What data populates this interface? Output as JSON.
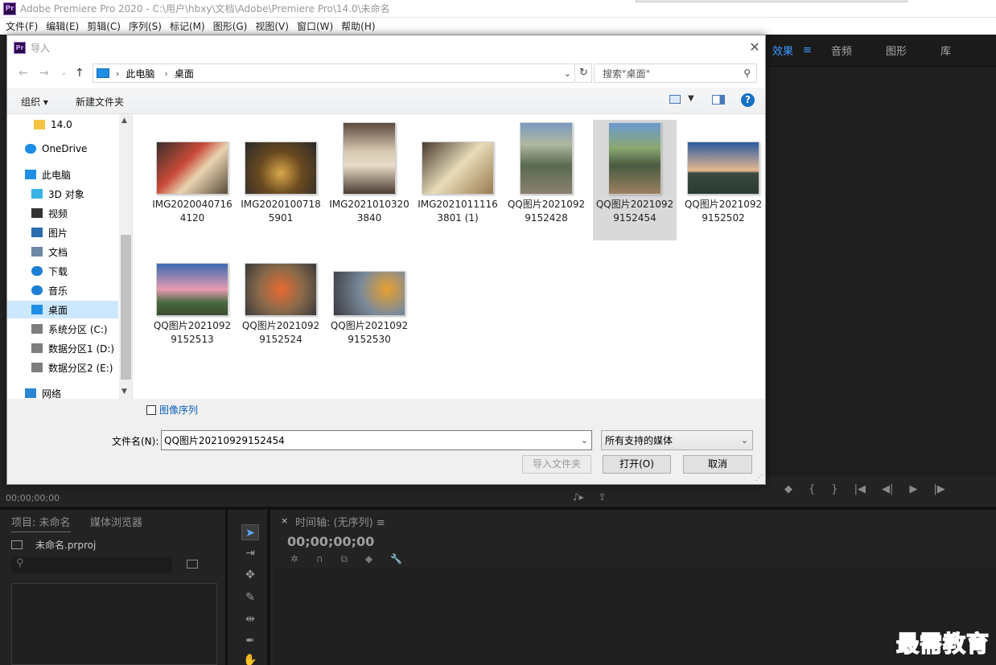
{
  "app": {
    "title": "Adobe Premiere Pro 2020 - C:\\用户\\hbxy\\文档\\Adobe\\Premiere Pro\\14.0\\未命名",
    "logo": "Pr",
    "menus": [
      "文件(F)",
      "编辑(E)",
      "剪辑(C)",
      "序列(S)",
      "标记(M)",
      "图形(G)",
      "视图(V)",
      "窗口(W)",
      "帮助(H)"
    ]
  },
  "right_panel": {
    "tabs": [
      "效果",
      "音频",
      "图形",
      "库"
    ],
    "tab_menu_icon": "≡",
    "controls": [
      "◆",
      "{",
      "}",
      "|◀",
      "◀|",
      "▶",
      "|▶"
    ]
  },
  "source_monitor": {
    "timecode": "00;00;00;00"
  },
  "project_panel": {
    "tab": "项目: 未命名",
    "tab2": "媒体浏览器",
    "file": "未命名.prproj",
    "search_placeholder": "⚲"
  },
  "timeline": {
    "close": "×",
    "title": "时间轴: (无序列) ≡",
    "timecode": "00;00;00;00"
  },
  "watermark": "最需教育",
  "dialog": {
    "title": "导入",
    "logo": "Pr",
    "close": "✕",
    "nav": {
      "back": "←",
      "forward": "→",
      "recent": "⌄",
      "up": "↑"
    },
    "breadcrumb": [
      "此电脑",
      "桌面"
    ],
    "search_placeholder": "搜索\"桌面\"",
    "organize": "组织 ▾",
    "new_folder": "新建文件夹",
    "help": "?",
    "sidebar": [
      {
        "label": "14.0",
        "icon": "folder-icon"
      },
      {
        "label": "OneDrive",
        "icon": "cloud-icon"
      },
      {
        "label": "此电脑",
        "icon": "computer-icon"
      },
      {
        "label": "3D 对象",
        "icon": "cube-icon"
      },
      {
        "label": "视频",
        "icon": "video-icon"
      },
      {
        "label": "图片",
        "icon": "picture-icon"
      },
      {
        "label": "文档",
        "icon": "document-icon"
      },
      {
        "label": "下载",
        "icon": "download-icon"
      },
      {
        "label": "音乐",
        "icon": "music-icon"
      },
      {
        "label": "桌面",
        "icon": "desktop-icon"
      },
      {
        "label": "系统分区 (C:)",
        "icon": "drive-icon"
      },
      {
        "label": "数据分区1 (D:)",
        "icon": "drive-icon"
      },
      {
        "label": "数据分区2 (E:)",
        "icon": "drive-icon"
      },
      {
        "label": "网络",
        "icon": "network-icon"
      }
    ],
    "files": [
      {
        "name": "IMG20200407164120"
      },
      {
        "name": "IMG20201007185901"
      },
      {
        "name": "IMG20210103203840"
      },
      {
        "name": "IMG20210111163801 (1)"
      },
      {
        "name": "QQ图片20210929152428"
      },
      {
        "name": "QQ图片20210929152454",
        "selected": true
      },
      {
        "name": "QQ图片20210929152502"
      },
      {
        "name": "QQ图片20210929152513"
      },
      {
        "name": "QQ图片20210929152524"
      },
      {
        "name": "QQ图片20210929152530"
      }
    ],
    "image_sequence_label": "图像序列",
    "filename_label": "文件名(N):",
    "filename_value": "QQ图片20210929152454",
    "filetype_value": "所有支持的媒体",
    "buttons": {
      "import_folder": "导入文件夹",
      "open": "打开(O)",
      "cancel": "取消"
    }
  },
  "colors": {
    "accent": "#3d9bff",
    "selection": "#cce8ff",
    "watermark": "#1d2e9c"
  }
}
